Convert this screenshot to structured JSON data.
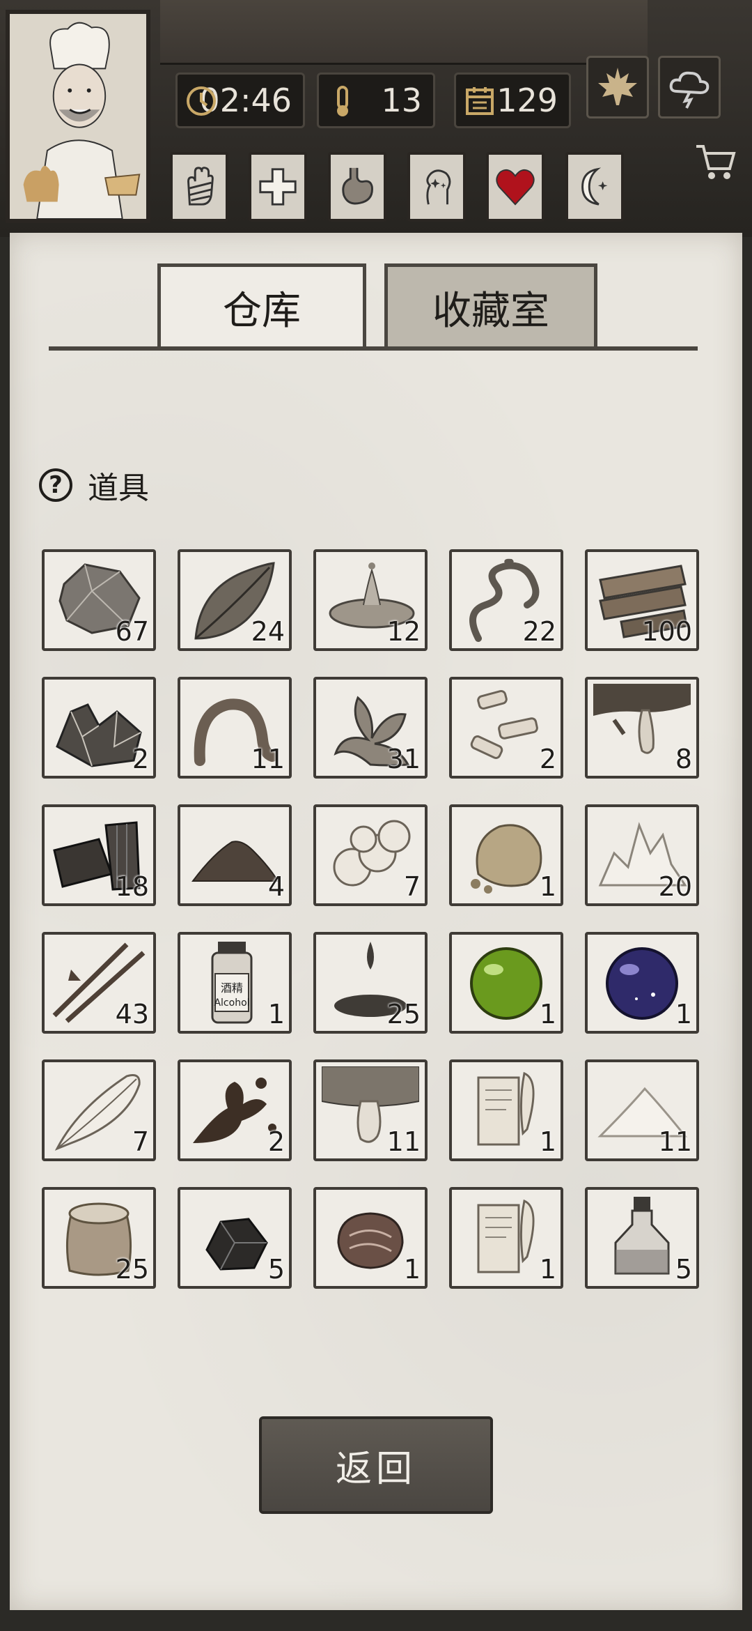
{
  "header": {
    "time": "02:46",
    "temperature": "13",
    "day": "129"
  },
  "tabs": [
    {
      "label": "仓库",
      "active": true
    },
    {
      "label": "收藏室",
      "active": false
    }
  ],
  "section": {
    "title": "道具",
    "help_icon": "?"
  },
  "items": [
    {
      "icon": "stone-icon",
      "count": "67"
    },
    {
      "icon": "leaf-icon",
      "count": "24"
    },
    {
      "icon": "water-puddle-icon",
      "count": "12"
    },
    {
      "icon": "vine-icon",
      "count": "22"
    },
    {
      "icon": "wood-planks-icon",
      "count": "100"
    },
    {
      "icon": "ore-crystal-icon",
      "count": "2"
    },
    {
      "icon": "worm-icon",
      "count": "11"
    },
    {
      "icon": "herb-icon",
      "count": "31"
    },
    {
      "icon": "bone-pieces-icon",
      "count": "2"
    },
    {
      "icon": "sap-drip-icon",
      "count": "8"
    },
    {
      "icon": "charcoal-icon",
      "count": "18"
    },
    {
      "icon": "dirt-pile-icon",
      "count": "4"
    },
    {
      "icon": "cotton-icon",
      "count": "7"
    },
    {
      "icon": "clay-rock-icon",
      "count": "1"
    },
    {
      "icon": "salt-crystal-icon",
      "count": "20"
    },
    {
      "icon": "spears-icon",
      "count": "43"
    },
    {
      "icon": "alcohol-bottle-icon",
      "count": "1"
    },
    {
      "icon": "oil-drop-icon",
      "count": "25"
    },
    {
      "icon": "green-orb-icon",
      "count": "1"
    },
    {
      "icon": "purple-orb-icon",
      "count": "1"
    },
    {
      "icon": "feather-icon",
      "count": "7"
    },
    {
      "icon": "mud-splash-icon",
      "count": "2"
    },
    {
      "icon": "fish-oil-icon",
      "count": "11"
    },
    {
      "icon": "scroll-quill-icon",
      "count": "1"
    },
    {
      "icon": "flour-pile-icon",
      "count": "11"
    },
    {
      "icon": "grain-sack-icon",
      "count": "25"
    },
    {
      "icon": "coal-lumps-icon",
      "count": "5"
    },
    {
      "icon": "meat-chunk-icon",
      "count": "1"
    },
    {
      "icon": "scroll-quill-icon",
      "count": "1"
    },
    {
      "icon": "potion-bottle-icon",
      "count": "5"
    }
  ],
  "back_label": "返回",
  "alcohol_label_cn": "酒精",
  "alcohol_label_en": "Alcohol"
}
